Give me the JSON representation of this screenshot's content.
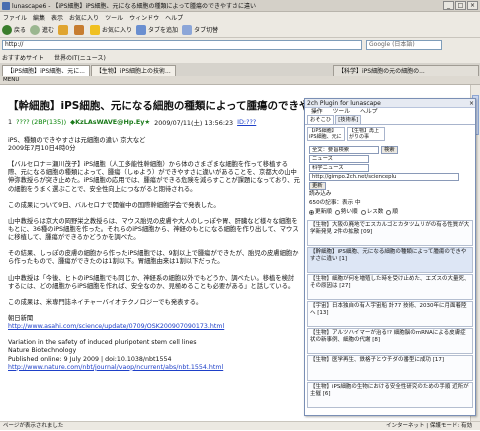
{
  "window": {
    "title": "lunascape6 - 【iPS細胞】iPS細胞、元になる細胞の種類によって腫瘍のできやすさに違い"
  },
  "menubar": [
    "ファイル",
    "編集",
    "表示",
    "お気に入り",
    "ツール",
    "ウィンドウ",
    "ヘルプ"
  ],
  "toolbar": {
    "back": "戻る",
    "forward": "進む",
    "favorites": "お気に入り",
    "tab_add": "タブを追加",
    "tab_list": "タブ切替"
  },
  "address": {
    "value": "http://",
    "search_placeholder": "Google (日本語)"
  },
  "bookmarks": [
    "おすすめサイト",
    "世界のIT(ニュース)"
  ],
  "tabs": [
    "【iPS細胞】iPS細胞、元に...",
    "【生物】iPS細胞上の技術...",
    "【科学】iPS細胞の元の細胞の..."
  ],
  "info_strip": "MENU",
  "article": {
    "title": "【幹細胞】iPS細胞、元になる細胞の種類によって腫瘍のできやすさに違い",
    "post_num": "1",
    "post_id": "???? (2BP(135))",
    "poster": "◆KzLAsWAVE@Hp.Ey★",
    "date": "2009/07/11(土) 13:56:23",
    "ref_link": "ID:???",
    "paragraphs": [
      "iPS、種類のできやすさは元細胞の違い 京大など",
      "2009年7月10日4時0分",
      "【バルセロナ＝瀬川茂子】iPS細胞（人工多能性幹細胞）から体のさまざまな細胞を作って移植する際、元になる細胞の種類によって、腫瘍（しゅよう）ができやすさに違いがあることを、京都大の山中伸弥教授らが突き止めた。iPS細胞の応用では、腫瘍ができる危険を減らすことが課題になっており、元の細胞をうまく選ぶことで、安全性向上につながると期待される。",
      "この成果について9日、バルセロナで開催中の国際幹細胞学会で発表した。",
      "山中教授らは京大の岡野栄之教授らは、マウス胎児の皮膚や大人のしっぽや胃、肝臓など様々な細胞をもとに、36種のiPS細胞を作った。それらのiPS細胞から、神経のもとになる細胞を作り出して、マウスに移植して、腫瘍ができるかどうかを調べた。",
      "その結果、しっぽの皮膚の細胞から作ったiPS細胞では、9割以上で腫瘍ができたが、胎児の皮膚細胞から作ったもので、腫瘍ができたのは1割以下。胃細胞由来は1割以下だった。",
      "山中教授は「今後、ヒトのiPS細胞でも同じか、神経系の細胞以外でもどうか、調べたい。移植を検討するには、どの細胞からiPS細胞を作れば、安全なのか、見極めることも必要がある」と話している。",
      "この成果は、米専門誌ネイチャーバイオテクノロジーでも発表する。",
      "朝日新聞",
      "http://www.asahi.com/science/update/0709/OSK200907090173.html",
      "Variation in the safety of induced pluripotent stem cell lines",
      "Nature Biotechnology",
      "Published online: 9 July 2009 | doi:10.1038/nbt1554",
      "http://www.nature.com/nbt/journal/vaop/ncurrent/abs/nbt.1554.html"
    ]
  },
  "panel": {
    "title": "2ch Plugin for lunascape",
    "menu": [
      "操作",
      "ツール",
      "ヘルプ"
    ],
    "tabs": [
      "おそこひ",
      "[技術系]"
    ],
    "sub_tabs": [
      "【iPS細胞】iPS細胞、元に",
      "【生物】再上がりの事"
    ],
    "fields": {
      "board_placeholder": "全文：要旨検索",
      "search_label": "検索",
      "category1": "ニュース",
      "category2": "科学ニュース",
      "url": "http://gimpo.2ch.net/scienceplu",
      "update_label": "更新",
      "interval_label": "読み込み",
      "count_label": "650の記事：表示 中",
      "radio_options": [
        "更新順",
        "勢い順",
        "レス数",
        "順"
      ]
    },
    "list": [
      "【生物】大阪の廃地でエスカルゴとカタツムリがの有る性質が大学新発見 2件の拡散 [09]",
      "【幹細胞】iPS細胞、元になる細胞の種類によって腫瘍のできやすさに違い [1]",
      "【生物】細胞が何を増殖した時を受け止めた、エズスの大量死、その原因は [27]",
      "【宇宙】日本独自の有人宇宙船 計77 技術、2030年に月面着陸へ [13]",
      "【生物】アルツハイマーが治る!? 細胞脳のmRNAによる皮膚症状の新事例、細胞の代謝 [8]",
      "【生物】医学再生、鉄格子とウチダの番型に成功 [17]",
      "【生物】iPS細胞の生物における安全性研究のための手順 近所が主催 [6]"
    ]
  },
  "status": {
    "left": "ページが表示されました",
    "right": "インターネット | 保護モード: 有効"
  }
}
